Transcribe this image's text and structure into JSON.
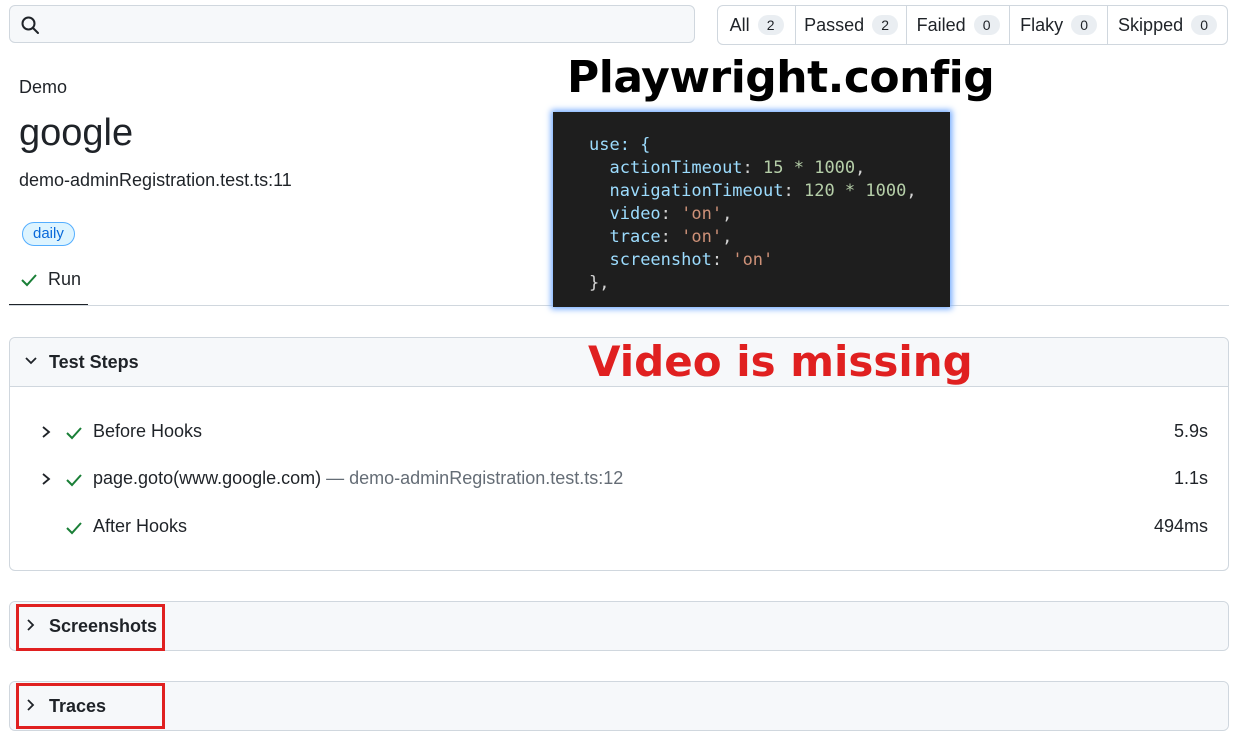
{
  "search": {
    "placeholder": ""
  },
  "filters": [
    {
      "label": "All",
      "count": "2"
    },
    {
      "label": "Passed",
      "count": "2"
    },
    {
      "label": "Failed",
      "count": "0"
    },
    {
      "label": "Flaky",
      "count": "0"
    },
    {
      "label": "Skipped",
      "count": "0"
    }
  ],
  "test": {
    "project": "Demo",
    "title": "google",
    "location": "demo-adminRegistration.test.ts:11",
    "tag": "daily",
    "tab": "Run"
  },
  "annotation": {
    "title": "Playwright.config",
    "missing": "Video is missing",
    "code": {
      "l1": "use: {",
      "l2_key": "actionTimeout",
      "l2_val": "15 * 1000",
      "l3_key": "navigationTimeout",
      "l3_val": "120 * 1000",
      "l4_key": "video",
      "l4_val": "'on'",
      "l5_key": "trace",
      "l5_val": "'on'",
      "l6_key": "screenshot",
      "l6_val": "'on'",
      "l7": "},"
    }
  },
  "panels": {
    "steps_label": "Test Steps",
    "steps": [
      {
        "label": "Before Hooks",
        "location": "",
        "duration": "5.9s",
        "expandable": true
      },
      {
        "label": "page.goto(www.google.com)",
        "location": " — demo-adminRegistration.test.ts:12",
        "duration": "1.1s",
        "expandable": true
      },
      {
        "label": "After Hooks",
        "location": "",
        "duration": "494ms",
        "expandable": false
      }
    ],
    "screenshots_label": "Screenshots",
    "traces_label": "Traces"
  },
  "colors": {
    "accent": "#0969da",
    "success": "#1a7f37",
    "annotation_red": "#e02020"
  }
}
